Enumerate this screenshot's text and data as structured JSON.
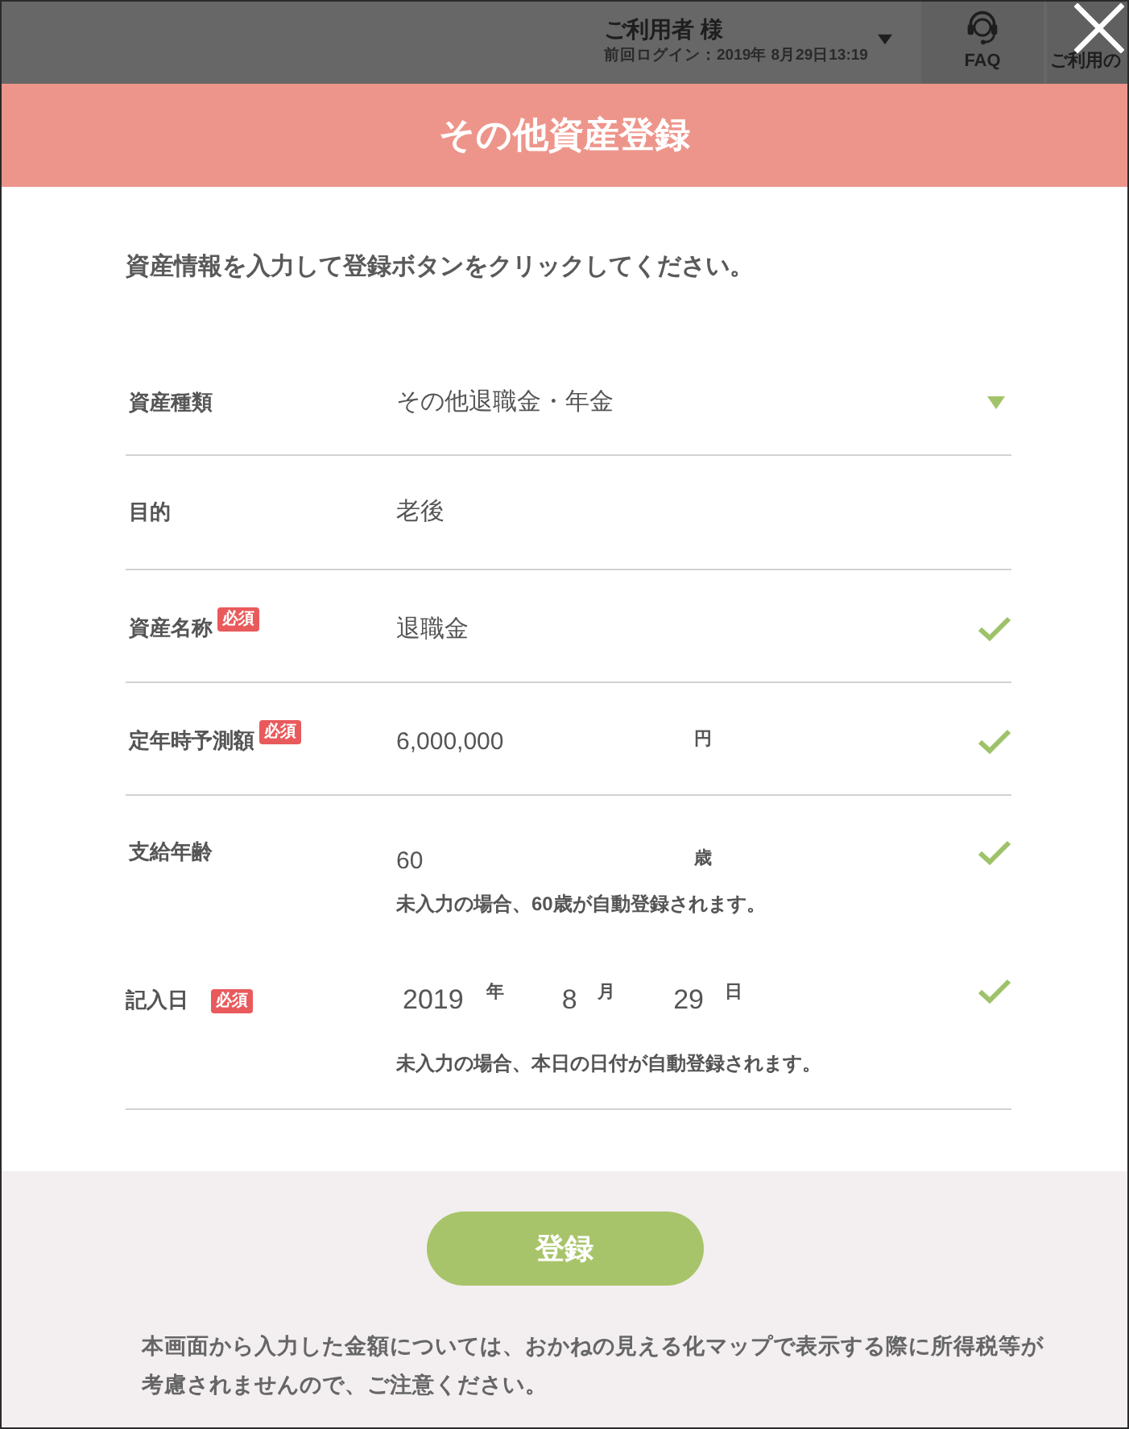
{
  "background_header": {
    "user_name": "ご利用者 様",
    "last_login": "前回ログイン：2019年 8月29日13:19",
    "nav_items": [
      {
        "kind": "faq",
        "label": "FAQ"
      },
      {
        "kind": "guide",
        "label": "ご利用の"
      }
    ]
  },
  "dialog": {
    "title": "その他資産登録",
    "intro": "資産情報を入力して登録ボタンをクリックしてください。",
    "fields": [
      {
        "kind": "select",
        "label": "資産種類",
        "value": "その他退職金・年金",
        "valid": false
      },
      {
        "kind": "text",
        "label": "目的",
        "value": "老後",
        "valid": false
      },
      {
        "kind": "input",
        "label": "資産名称",
        "badge": "必須",
        "value": "退職金",
        "valid": true
      },
      {
        "kind": "input",
        "label": "定年時予測額",
        "badge": "必須",
        "value": "6,000,000",
        "unit": "円",
        "valid": true
      },
      {
        "kind": "input",
        "label": "支給年齢",
        "value": "60",
        "unit": "歳",
        "note": "未入力の場合、60歳が自動登録されます。",
        "valid": true
      },
      {
        "kind": "date",
        "label": "記入日",
        "badge": "必須",
        "parts": [
          {
            "value": "2019",
            "unit": "年"
          },
          {
            "value": "8",
            "unit": "月"
          },
          {
            "value": "29",
            "unit": "日"
          }
        ],
        "note": "未入力の場合、本日の日付が自動登録されます。",
        "valid": true
      }
    ],
    "submit_button": "登録",
    "notice": "本画面から入力した金額については、おかねの見える化マップで表示する際に所得税等が考慮されませんので、ご注意ください。"
  }
}
